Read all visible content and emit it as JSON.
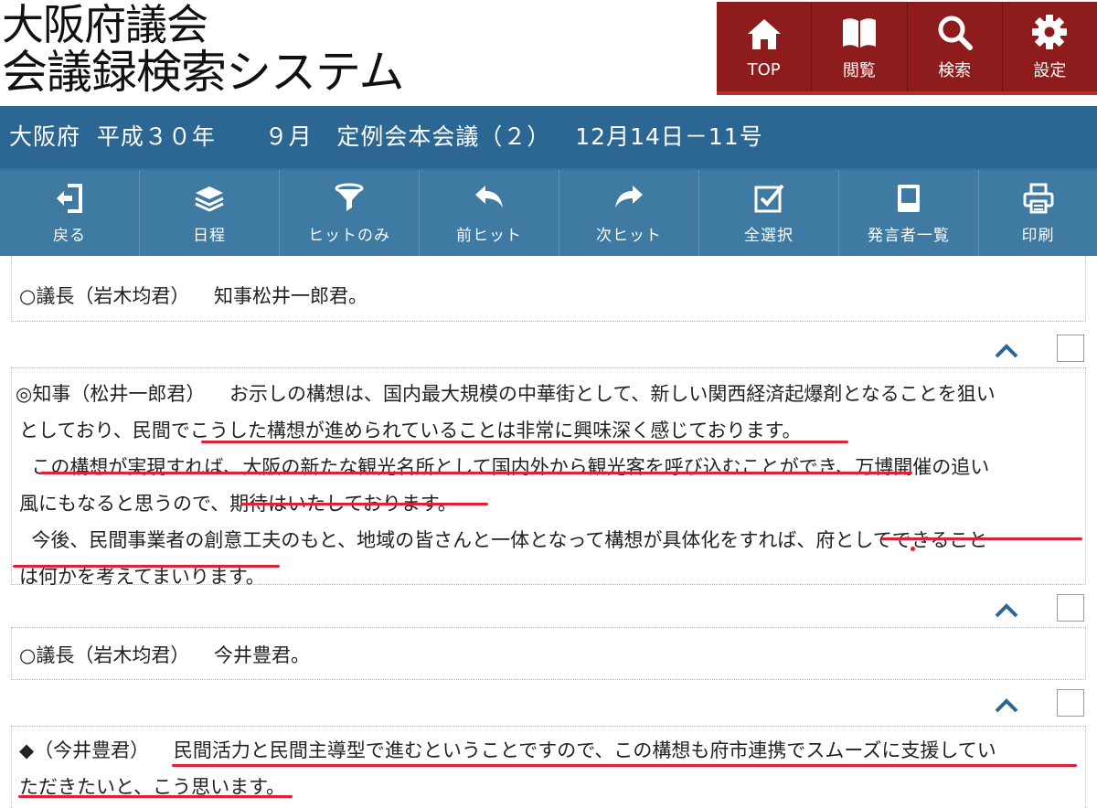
{
  "header": {
    "logo_line1": "大阪府議会",
    "logo_line2": "会議録検索システム",
    "nav": [
      {
        "label": "TOP",
        "icon": "home-icon"
      },
      {
        "label": "閲覧",
        "icon": "book-icon"
      },
      {
        "label": "検索",
        "icon": "search-icon"
      },
      {
        "label": "設定",
        "icon": "gear-icon"
      }
    ]
  },
  "title_bar": "大阪府  平成３０年      ９月   定例会本会議（２）   12月14日－11号",
  "toolbar": [
    {
      "label": "戻る",
      "icon": "back-icon"
    },
    {
      "label": "日程",
      "icon": "layers-icon"
    },
    {
      "label": "ヒットのみ",
      "icon": "filter-icon"
    },
    {
      "label": "前ヒット",
      "icon": "prev-arrow-icon"
    },
    {
      "label": "次ヒット",
      "icon": "next-arrow-icon"
    },
    {
      "label": "全選択",
      "icon": "checkbox-icon"
    },
    {
      "label": "発言者一覧",
      "icon": "speaker-list-icon"
    },
    {
      "label": "印刷",
      "icon": "print-icon"
    }
  ],
  "colors": {
    "nav_bg": "#8f1c1c",
    "title_bg": "#2c6693",
    "toolbar_bg": "#3f7aa3",
    "underline": "#e0203a"
  },
  "utterances": [
    {
      "line1": "○議長（岩木均君）    知事松井一郎君。"
    },
    {
      "line1": "◎知事（松井一郎君）    お示しの構想は、国内最大規模の中華街として、新しい関西経済起爆剤となることを狙い",
      "line2": "としており、民間でこうした構想が進められていることは非常に興味深く感じております。",
      "line3": "  この構想が実現すれば、大阪の新たな観光名所として国内外から観光客を呼び込むことができ、万博開催の追い",
      "line4": "風にもなると思うので、期待はいたしております。",
      "line5": "  今後、民間事業者の創意工夫のもと、地域の皆さんと一体となって構想が具体化をすれば、府としてできること",
      "line6": "は何かを考えてまいります。"
    },
    {
      "line1": "○議長（岩木均君）    今井豊君。"
    },
    {
      "line1": "◆（今井豊君）    民間活力と民間主導型で進むということですので、この構想も府市連携でスムーズに支援してい",
      "line2": "ただきたいと、こう思います。"
    }
  ]
}
